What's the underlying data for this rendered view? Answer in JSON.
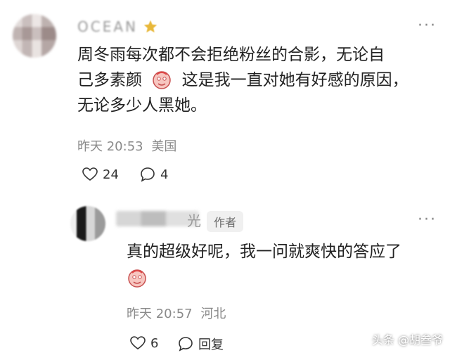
{
  "comment1": {
    "username": "OCEAN",
    "text_line1": "周冬雨每次都不会拒绝粉丝的合影，无论自",
    "text_line2a": "己多素颜",
    "text_line2b": "这是我一直对她有好感的原因，",
    "text_line3": "无论多少人黑她。",
    "time": "昨天 20:53",
    "location": "美国",
    "likes": "24",
    "replies": "4"
  },
  "reply1": {
    "name_fragment": "光",
    "author_badge": "作者",
    "text": "真的超级好呢，我一问就爽快的答应了",
    "time": "昨天 20:57",
    "location": "河北",
    "likes": "6",
    "reply_label": "回复"
  },
  "more_symbol": "···",
  "watermark": "头条 @胡叁爷",
  "icons": [
    "heart-icon",
    "comment-bubble-icon",
    "emoji-face-icon",
    "more-icon",
    "star-icon"
  ]
}
